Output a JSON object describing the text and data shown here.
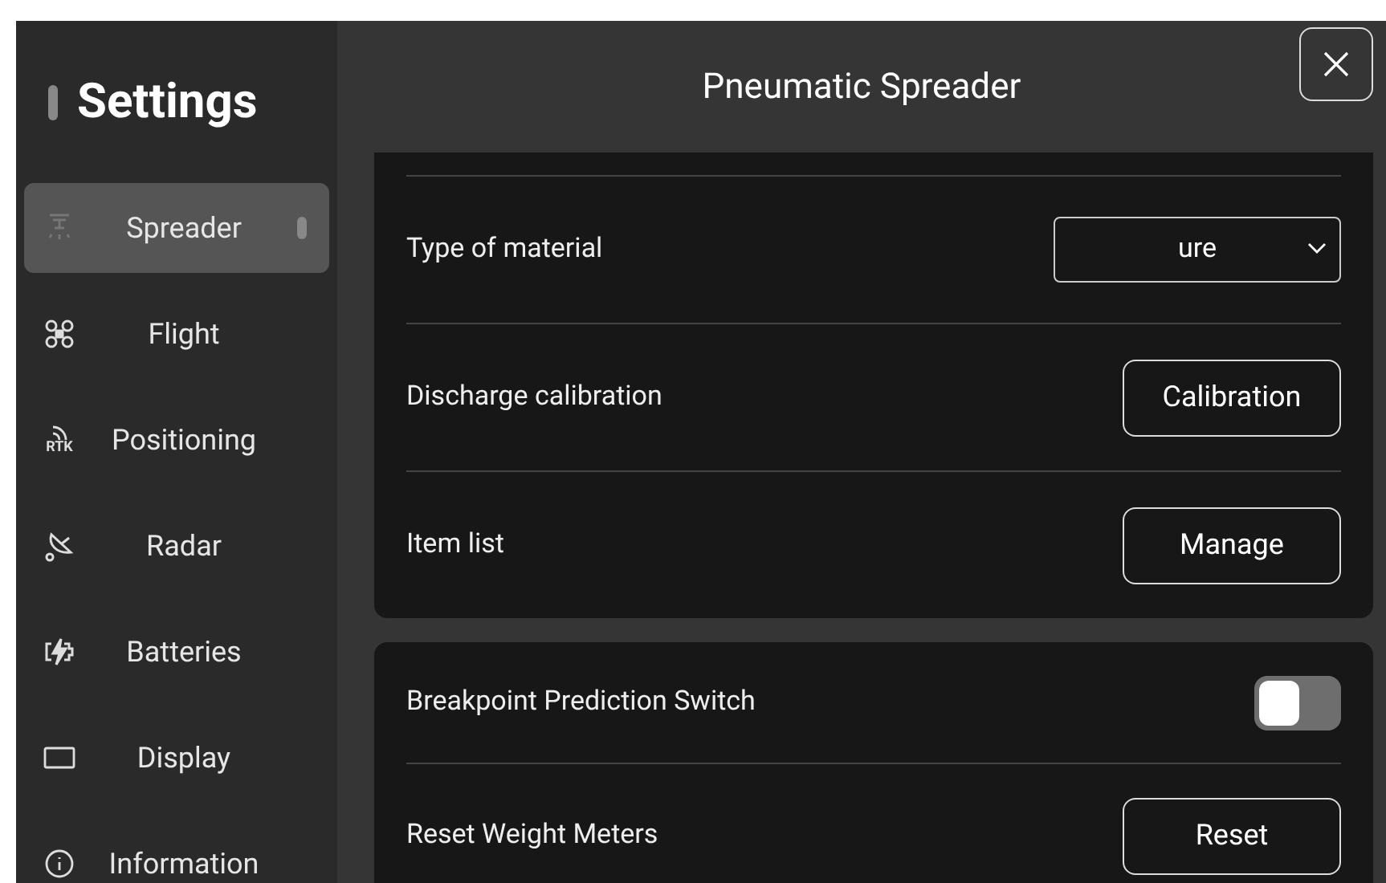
{
  "sidebar": {
    "title": "Settings",
    "items": [
      {
        "label": "Spreader",
        "selected": true
      },
      {
        "label": "Flight",
        "selected": false
      },
      {
        "label": "Positioning",
        "icon_text": "RTK",
        "selected": false
      },
      {
        "label": "Radar",
        "selected": false
      },
      {
        "label": "Batteries",
        "selected": false
      },
      {
        "label": "Display",
        "selected": false
      },
      {
        "label": "Information",
        "selected": false
      }
    ]
  },
  "panel": {
    "title": "Pneumatic Spreader",
    "cards": [
      {
        "rows": [
          {
            "kind": "select",
            "label": "Type of material",
            "value": "ure"
          },
          {
            "kind": "button",
            "label": "Discharge calibration",
            "button": "Calibration"
          },
          {
            "kind": "button",
            "label": "Item list",
            "button": "Manage"
          }
        ]
      },
      {
        "rows": [
          {
            "kind": "toggle",
            "label": "Breakpoint Prediction Switch",
            "on": false
          },
          {
            "kind": "button",
            "label": "Reset Weight Meters",
            "button": "Reset"
          }
        ]
      }
    ]
  }
}
